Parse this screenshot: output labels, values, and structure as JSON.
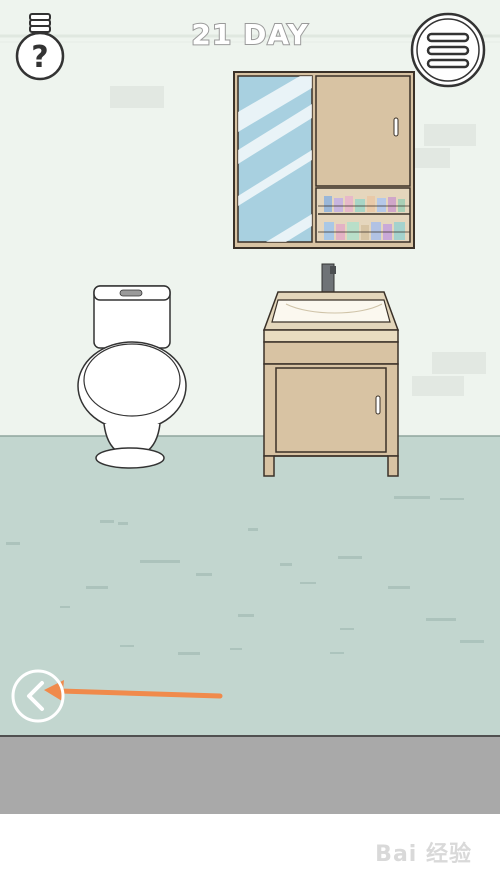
{
  "hud": {
    "day_label": "21 DAY",
    "hint_icon": "lightbulb-question-icon",
    "menu_icon": "hamburger-menu-icon",
    "back_icon": "chevron-left-icon"
  },
  "annotation": {
    "arrow_color": "#f08a4b",
    "arrow_target": "back-button"
  },
  "colors": {
    "wall": "#eef4ee",
    "floor": "#c2d6cf",
    "cabinet": "#d8c3a3",
    "mirror": "#a8d0e0",
    "bottom_bar": "#a9a9a9"
  },
  "watermark": {
    "text": "Bai 经验"
  }
}
